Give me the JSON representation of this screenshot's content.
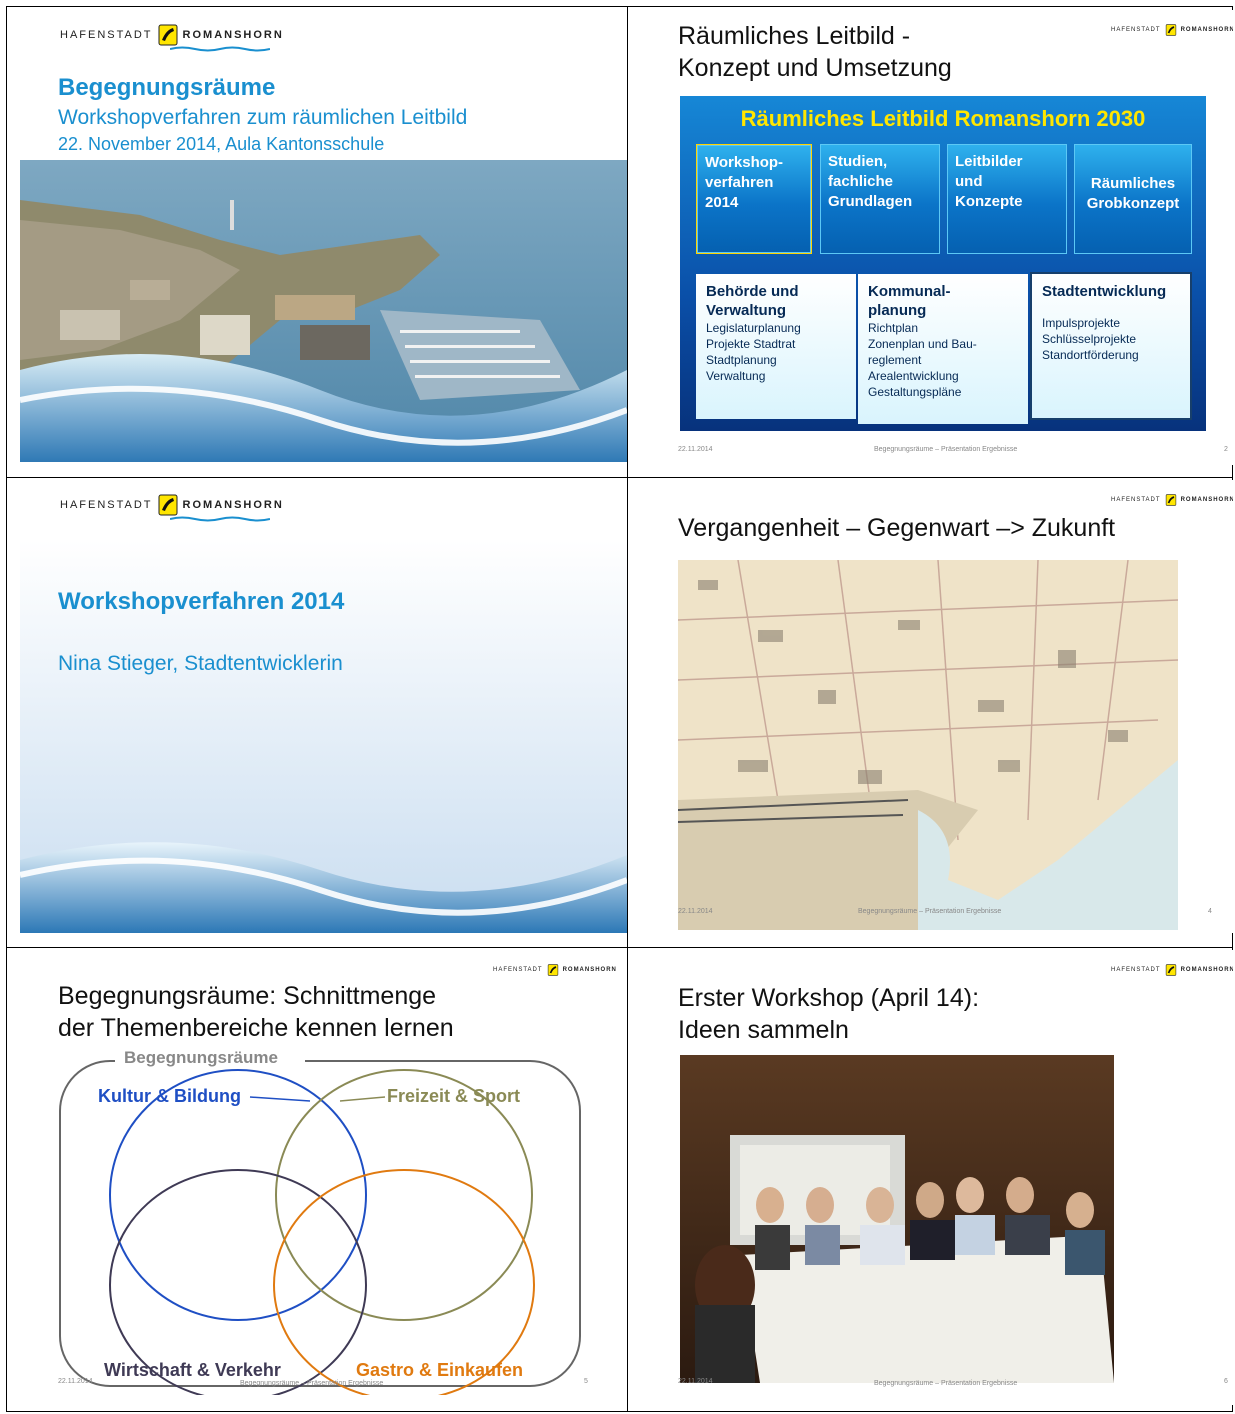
{
  "logo": {
    "left_word": "HAFENSTADT",
    "right_word": "ROMANSHORN",
    "icon": "horn-crest-icon"
  },
  "colors": {
    "accent": "#1a8fcf",
    "dark_blue": "#0a2a6e",
    "yellow": "#ffe600"
  },
  "slide1": {
    "title": "Begegnungsräume",
    "subtitle": "Workshopverfahren zum räumlichen Leitbild",
    "date_place": "22. November 2014, Aula Kantonsschule"
  },
  "slide2": {
    "title_line1": "Räumliches Leitbild -",
    "title_line2": "Konzept und Umsetzung",
    "banner": "Räumliches Leitbild Romanshorn 2030",
    "top_boxes": [
      {
        "line1": "Workshop-",
        "line2": "verfahren",
        "line3": "2014"
      },
      {
        "line1": "Studien,",
        "line2": "fachliche",
        "line3": "Grundlagen"
      },
      {
        "line1": "Leitbilder",
        "line2": "und",
        "line3": "Konzepte"
      },
      {
        "line1": "Räumliches",
        "line2": "Grobkonzept",
        "line3": ""
      }
    ],
    "bottom_boxes": [
      {
        "h1": "Behörde und",
        "h2": "Verwaltung",
        "items": [
          "Legislaturplanung",
          "Projekte Stadtrat",
          "Stadtplanung",
          "Verwaltung"
        ]
      },
      {
        "h1": "Kommunal-",
        "h2": "planung",
        "items": [
          "Richtplan",
          "Zonenplan und Bau-",
          "reglement",
          "Arealentwicklung",
          "Gestaltungspläne"
        ]
      },
      {
        "h1": "Stadtentwicklung",
        "h2": "",
        "items": [
          "Impulsprojekte",
          "Schlüsselprojekte",
          "Standortförderung"
        ]
      }
    ],
    "footer_date": "22.11.2014",
    "footer_center": "Begegnungsräume – Präsentation Ergebnisse",
    "page": "2"
  },
  "slide3": {
    "title": "Workshopverfahren 2014",
    "presenter": "Nina Stieger, Stadtentwicklerin"
  },
  "slide4": {
    "title": "Vergangenheit – Gegenwart –> Zukunft",
    "footer_date": "22.11.2014",
    "footer_center": "Begegnungsräume – Präsentation Ergebnisse",
    "page": "4"
  },
  "slide5": {
    "title_line1": "Begegnungsräume: Schnittmenge",
    "title_line2": "der Themenbereiche kennen lernen",
    "frame_label": "Begegnungsräume",
    "circles": [
      {
        "label": "Kultur & Bildung",
        "color": "#1f4fc4"
      },
      {
        "label": "Freizeit & Sport",
        "color": "#8a8a55"
      },
      {
        "label": "Wirtschaft & Verkehr",
        "color": "#3f3a55"
      },
      {
        "label": "Gastro & Einkaufen",
        "color": "#e07a10"
      }
    ],
    "footer_date": "22.11.2014",
    "footer_center": "Begegnungsräume – Präsentation Ergebnisse",
    "page": "5"
  },
  "slide6": {
    "title_line1": "Erster Workshop (April 14):",
    "title_line2": "Ideen sammeln",
    "footer_date": "22.11.2014",
    "footer_center": "Begegnungsräume – Präsentation Ergebnisse",
    "page": "6"
  }
}
